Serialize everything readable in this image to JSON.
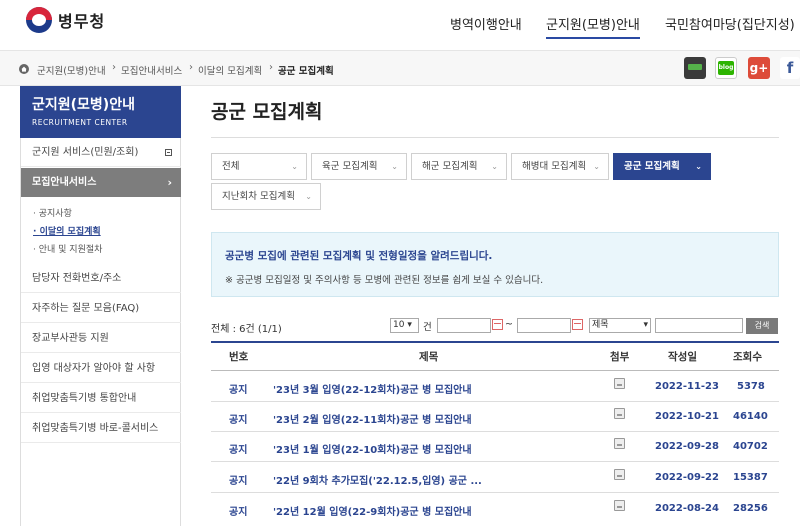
{
  "header": {
    "logo_text": "병무청",
    "nav": [
      "병역이행안내",
      "군지원(모병)안내",
      "국민참여마당(집단지성)"
    ]
  },
  "breadcrumb": [
    "군지원(모병)안내",
    "모집안내서비스",
    "이달의 모집계획",
    "공군 모집계획"
  ],
  "sns": {
    "blog": "blog",
    "gplus": "g+",
    "fb": "f"
  },
  "sidebar": {
    "title": "군지원(모병)안내",
    "subtitle": "RECRUITMENT CENTER",
    "items": [
      "군지원 서비스(민원/조회)",
      "모집안내서비스",
      "담당자 전화번호/주소",
      "자주하는 질문 모음(FAQ)",
      "장교부사관등 지원",
      "입영 대상자가 알아야 할 사항",
      "취업맞춤특기병 통합안내",
      "취업맞춤특기병 바로-콜서비스"
    ],
    "sub_items": [
      "공지사항",
      "이달의 모집계획",
      "안내 및 지원절차"
    ]
  },
  "main": {
    "title": "공군 모집계획",
    "tabs": [
      "전체",
      "육군 모집계획",
      "해군 모집계획",
      "해병대 모집계획",
      "공군 모집계획",
      "지난회차 모집계획"
    ],
    "notice_line1": "공군병 모집에 관련된 모집계획 및 전형일정을 알려드립니다.",
    "notice_line2": "※ 공군병 모집일정 및 주의사항 등 모병에 관련된 정보를 쉽게 보실 수 있습니다."
  },
  "search": {
    "total": "전체 : 6건 (1/1)",
    "page_size": "10",
    "unit": "건",
    "tilde": "~",
    "field": "제목",
    "button": "검색"
  },
  "table": {
    "headers": [
      "번호",
      "제목",
      "첨부",
      "작성일",
      "조회수"
    ],
    "rows": [
      {
        "no": "공지",
        "title": "'23년 3월 입영(22-12회차)공군 병 모집안내",
        "date": "2022-11-23",
        "views": "5378"
      },
      {
        "no": "공지",
        "title": "'23년 2월 입영(22-11회차)공군 병 모집안내",
        "date": "2022-10-21",
        "views": "46140"
      },
      {
        "no": "공지",
        "title": "'23년 1월 입영(22-10회차)공군 병 모집안내",
        "date": "2022-09-28",
        "views": "40702"
      },
      {
        "no": "공지",
        "title": "'22년 9회차 추가모집('22.12.5,입영) 공군 ...",
        "date": "2022-09-22",
        "views": "15387"
      },
      {
        "no": "공지",
        "title": "'22년 12월 입영(22-9회차)공군 병 모집안내",
        "date": "2022-08-24",
        "views": "28256"
      }
    ]
  }
}
